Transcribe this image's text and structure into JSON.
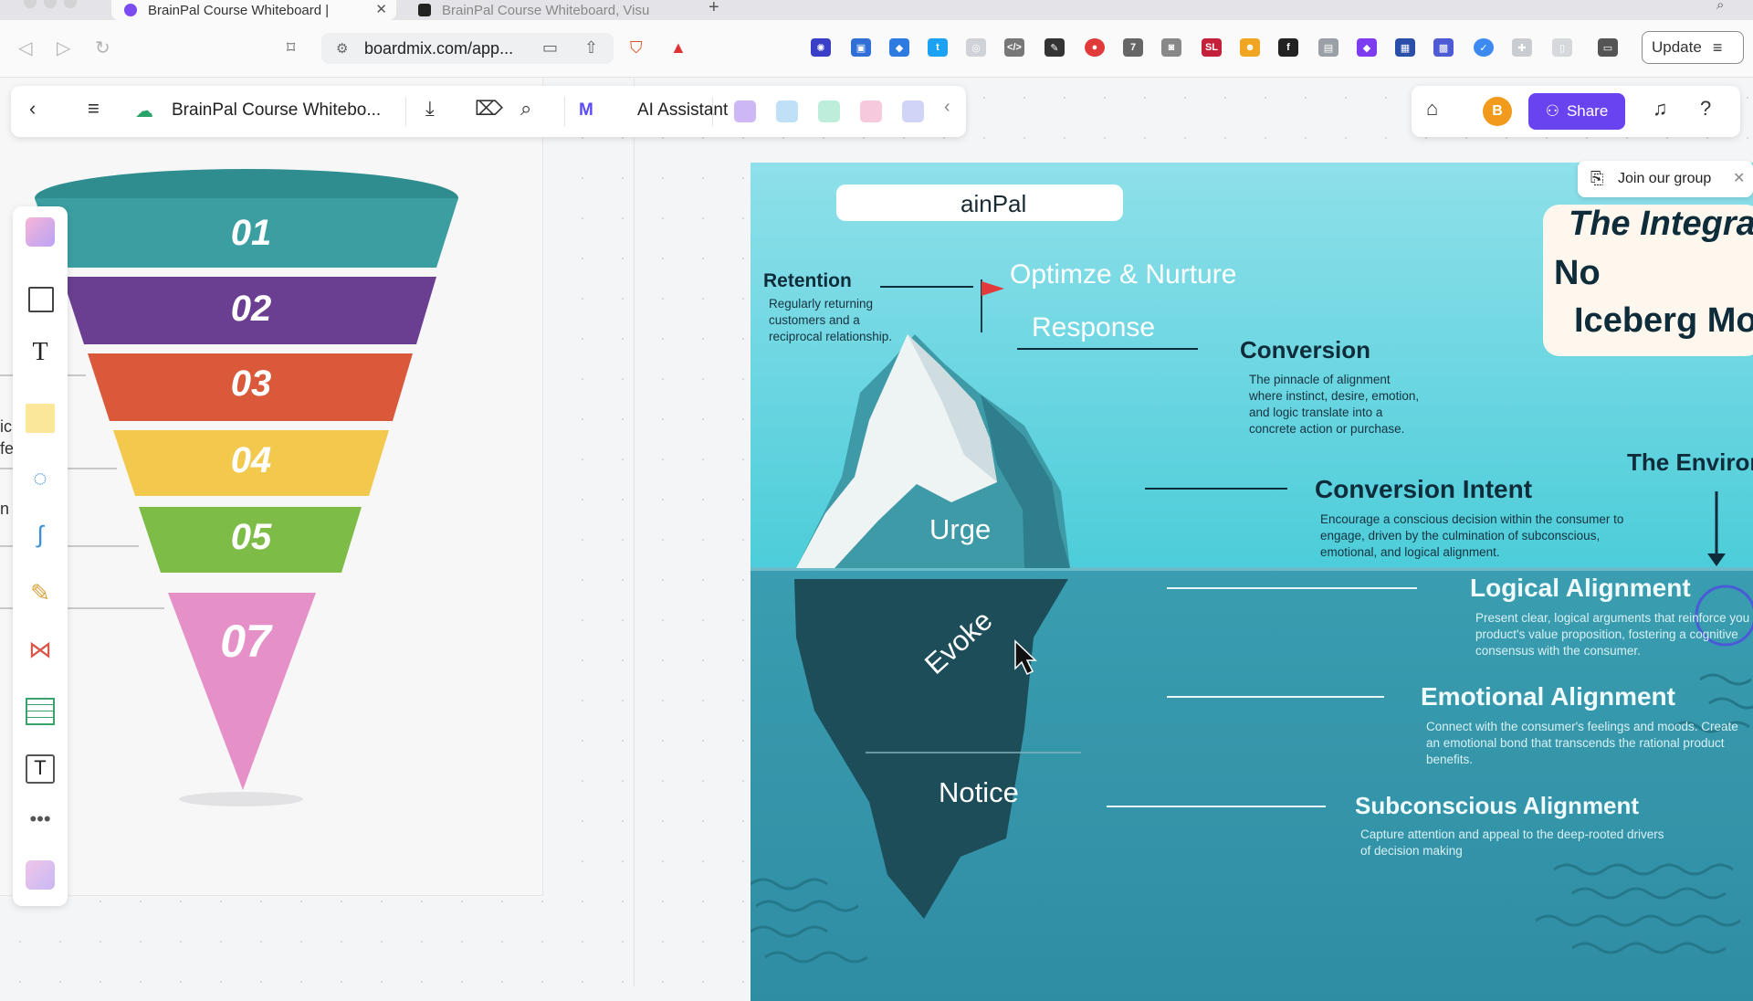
{
  "browser": {
    "tabs": [
      {
        "title": "BrainPal Course Whiteboard |",
        "active": true
      },
      {
        "title": "BrainPal Course Whiteboard, Visu",
        "active": false
      }
    ],
    "url": "boardmix.com/app...",
    "update_label": "Update"
  },
  "toolbar": {
    "doc_title": "BrainPal Course Whitebo...",
    "ai_assistant_label": "AI Assistant",
    "share_label": "Share",
    "avatar_initial": "B",
    "join_group_label": "Join our group"
  },
  "funnel": {
    "levels": [
      "01",
      "02",
      "03",
      "04",
      "05",
      "07"
    ],
    "colors": [
      "#3b9ea1",
      "#6a3f91",
      "#d9593a",
      "#f2c94c",
      "#7cbc47",
      "#e690c8"
    ],
    "left_edge_fragments": [
      "ic",
      "fe",
      "n"
    ]
  },
  "iceberg": {
    "brand_fragment": "ainPal",
    "title_fragments": [
      "The Integra",
      "No",
      "Iceberg Mo"
    ],
    "environment_fragment": "The Environ",
    "flag_text": "Optimze & Nurture",
    "response_text": "Response",
    "layers": [
      "Urge",
      "Evoke",
      "Notice"
    ],
    "retention": {
      "title": "Retention",
      "lines": [
        "Regularly returning",
        "customers and a",
        "reciprocal relationship."
      ]
    },
    "conversion": {
      "title": "Conversion",
      "lines": [
        "The pinnacle of alignment",
        "where instinct, desire, emotion,",
        "and logic translate into a",
        "concrete action or purchase."
      ]
    },
    "conversion_intent": {
      "title": "Conversion Intent",
      "lines": [
        "Encourage a conscious decision within the consumer to",
        "engage, driven by the culmination of subconscious,",
        "emotional, and logical alignment."
      ]
    },
    "logical": {
      "title": "Logical Alignment",
      "lines": [
        "Present clear, logical arguments that reinforce you",
        "product's value proposition, fostering a cognitive",
        "consensus with the consumer."
      ]
    },
    "emotional": {
      "title": "Emotional Alignment",
      "lines": [
        "Connect with the consumer's feelings and moods. Create",
        "an emotional bond that transcends the rational product",
        "benefits."
      ]
    },
    "subconscious": {
      "title": "Subconscious Alignment",
      "lines": [
        "Capture attention and appeal to the deep-rooted drivers",
        "of decision making"
      ]
    }
  }
}
